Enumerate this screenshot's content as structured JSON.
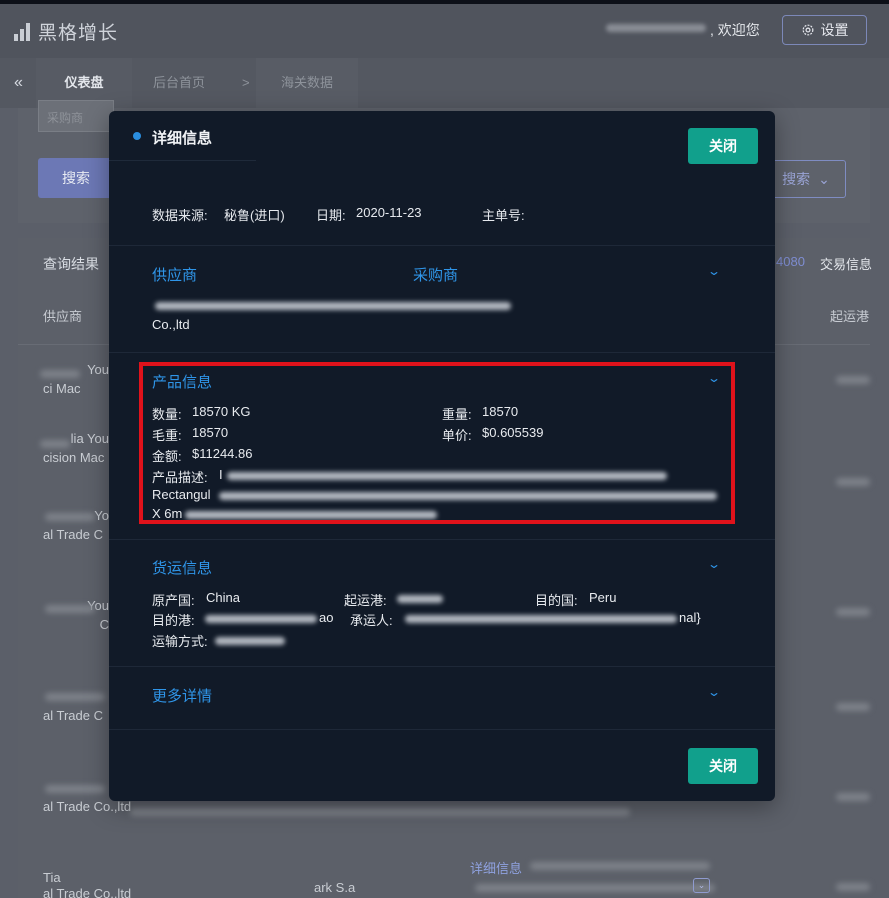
{
  "header": {
    "brand": "黑格增长",
    "welcome": ", 欢迎您",
    "settings_label": "设置"
  },
  "breadcrumb": {
    "tab_dashboard": "仪表盘",
    "home": "后台首页",
    "separator": ">",
    "customs": "海关数据"
  },
  "background": {
    "input_placeholder": "采购商",
    "search_label": "搜索",
    "advanced_search_label": "搜索",
    "result_title": "查询结果",
    "result_count": "4080",
    "trade_info_label": "交易信息",
    "col_supplier": "供应商",
    "col_origin_port": "起运港",
    "rows": [
      {
        "line1": "You",
        "line2": "ci     Mac"
      },
      {
        "line1": "lia You",
        "line2": "cision Mac"
      },
      {
        "line1": "Yo",
        "line2": "al Trade C"
      },
      {
        "line1": "You",
        "line2": "C"
      },
      {
        "line1": "",
        "line2": "al Trade C"
      },
      {
        "line1": "",
        "line2": "al Trade Co.,ltd"
      },
      {
        "line1": "Tia",
        "line2": "al Trade Co.,ltd"
      }
    ],
    "buyer_partial": "ark S.a",
    "detail_link": "详细信息"
  },
  "modal": {
    "title": "详细信息",
    "close_label": "关闭",
    "data_source_label": "数据来源:",
    "data_source_value": "秘鲁(进口)",
    "date_label": "日期:",
    "date_value": "2020-11-23",
    "master_bill_label": "主单号:",
    "parties": {
      "supplier_label": "供应商",
      "buyer_label": "采购商",
      "supplier_suffix": "Co.,ltd"
    },
    "product": {
      "title": "产品信息",
      "quantity_label": "数量:",
      "quantity_value": "18570 KG",
      "weight_label": "重量:",
      "weight_value": "18570",
      "gross_weight_label": "毛重:",
      "gross_weight_value": "18570",
      "unit_price_label": "单价:",
      "unit_price_value": "$0.605539",
      "amount_label": "金额:",
      "amount_value": "$11244.86",
      "description_label": "产品描述:",
      "description_prefix": "I",
      "description_line2": "Rectangul",
      "description_line3": "X 6m"
    },
    "shipping": {
      "title": "货运信息",
      "origin_country_label": "原产国:",
      "origin_country_value": "China",
      "port_of_loading_label": "起运港:",
      "destination_country_label": "目的国:",
      "destination_country_value": "Peru",
      "destination_port_label": "目的港:",
      "destination_port_suffix": "ao",
      "carrier_label": "承运人:",
      "carrier_suffix": "nal}",
      "transport_mode_label": "运输方式:"
    },
    "more": {
      "title": "更多详情"
    }
  },
  "colors": {
    "modal_bg": "#111a28",
    "accent_blue": "#2f95e8",
    "close_button": "#11a08c",
    "highlight_red": "#e0121b"
  },
  "icons": {
    "brand": "bar-chart-icon",
    "settings": "gear-icon",
    "collapse": "double-chevron-left-icon",
    "chevron": "chevron-down-icon"
  }
}
